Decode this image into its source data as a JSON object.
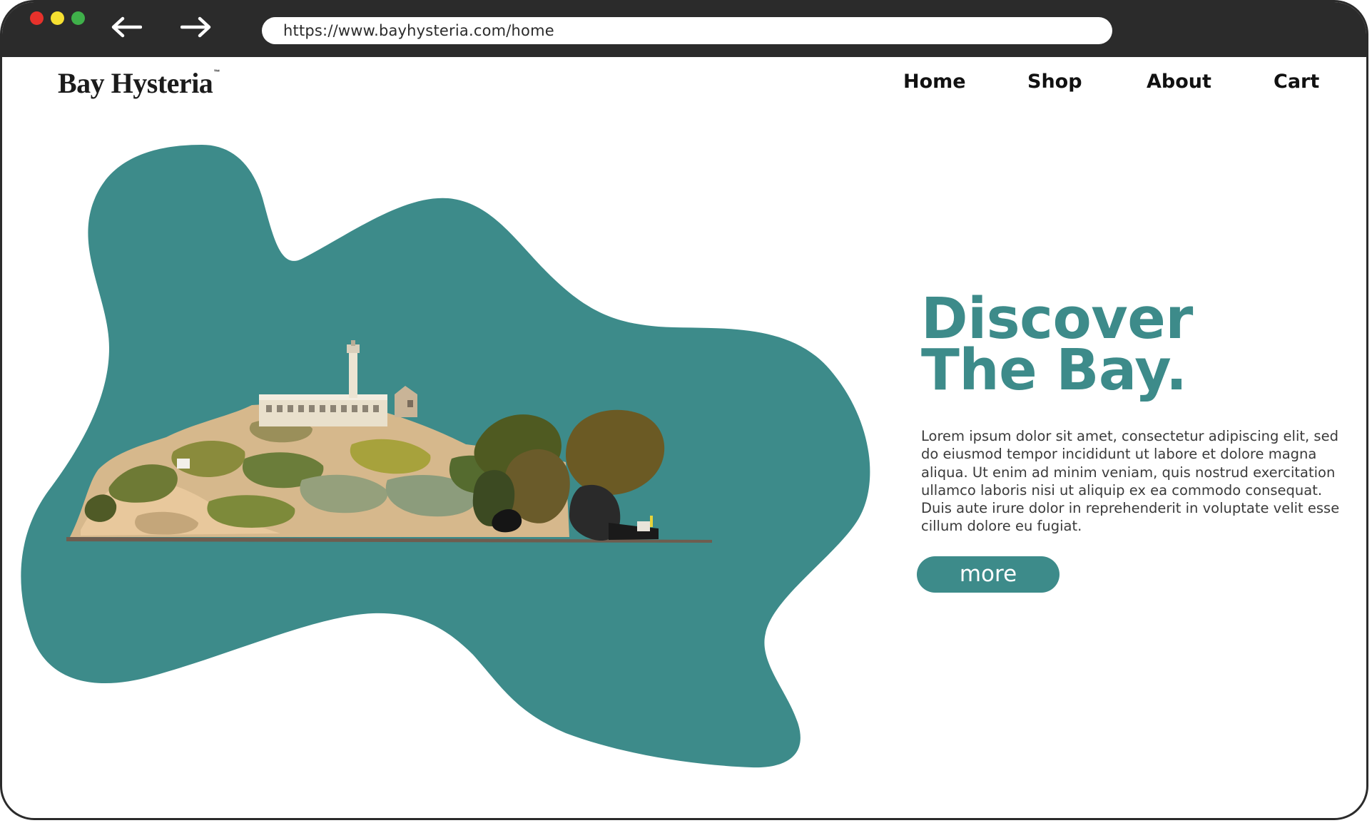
{
  "browser": {
    "url": "https://www.bayhysteria.com/home",
    "back_icon": "arrow-left-icon",
    "forward_icon": "arrow-right-icon"
  },
  "brand": {
    "name": "Bay Hysteria",
    "trademark": "™"
  },
  "nav": {
    "items": [
      {
        "label": "Home"
      },
      {
        "label": "Shop"
      },
      {
        "label": "About"
      },
      {
        "label": "Cart"
      }
    ]
  },
  "hero": {
    "headline_line1": "Discover",
    "headline_line2": "The Bay.",
    "body": "Lorem ipsum dolor sit amet, consectetur adipiscing elit, sed do eiusmod tempor incididunt ut labore et dolore magna aliqua. Ut enim ad minim veniam, quis nostrud exercitation ullamco laboris nisi ut aliquip ex ea commodo consequat. Duis aute irure dolor in reprehenderit in voluptate velit esse cillum dolore eu fugiat.",
    "more_label": "more"
  },
  "colors": {
    "accent": "#3d8b8a",
    "chrome": "#2b2b2b",
    "text": "#3a3a3a"
  }
}
